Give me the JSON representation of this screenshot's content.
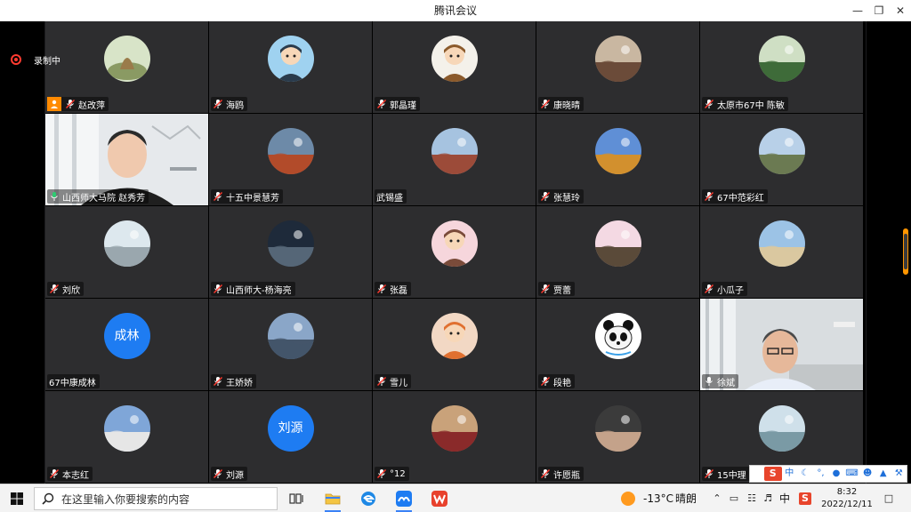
{
  "window": {
    "title": "腾讯会议"
  },
  "recording": {
    "label": "录制中"
  },
  "tiles": [
    {
      "name": "赵改萍",
      "kind": "avatar",
      "av": "landscape",
      "c1": "#d8e4c8",
      "c2": "#8a9a63",
      "host": true
    },
    {
      "name": "海鸥",
      "kind": "avatar",
      "av": "cartoon",
      "c1": "#9fd2f0",
      "c2": "#2a3b4c"
    },
    {
      "name": "郭晶瑾",
      "kind": "avatar",
      "av": "cartoon",
      "c1": "#f4f1ea",
      "c2": "#8b5a2b"
    },
    {
      "name": "康晓晴",
      "kind": "avatar",
      "av": "photo",
      "c1": "#c9b7a1",
      "c2": "#6b4b3a"
    },
    {
      "name": "太原市67中 陈敏",
      "kind": "avatar",
      "av": "photo",
      "c1": "#cfdfc4",
      "c2": "#3f6b3a"
    },
    {
      "name": "山西师大马院 赵秀芳",
      "kind": "video",
      "speaking": true
    },
    {
      "name": "十五中景慧芳",
      "kind": "avatar",
      "av": "photo",
      "c1": "#6d8aa8",
      "c2": "#b24b2a"
    },
    {
      "name": "武锡盛",
      "kind": "avatar",
      "av": "photo",
      "c1": "#a6c3e0",
      "c2": "#9c4b3a",
      "nomic": true
    },
    {
      "name": "张慧玲",
      "kind": "avatar",
      "av": "photo",
      "c1": "#5f8fd6",
      "c2": "#d2902e"
    },
    {
      "name": "67中范彩红",
      "kind": "avatar",
      "av": "photo",
      "c1": "#b8d0e8",
      "c2": "#6b7b52"
    },
    {
      "name": "刘欣",
      "kind": "avatar",
      "av": "photo",
      "c1": "#dde8ee",
      "c2": "#9aa7ae"
    },
    {
      "name": "山西师大-杨海亮",
      "kind": "avatar",
      "av": "photo",
      "c1": "#1e2a3a",
      "c2": "#556677"
    },
    {
      "name": "张磊",
      "kind": "avatar",
      "av": "cartoon",
      "c1": "#f6d6dc",
      "c2": "#7a4b3a"
    },
    {
      "name": "贾蕾",
      "kind": "avatar",
      "av": "photo",
      "c1": "#f4d9e3",
      "c2": "#5a4a3a"
    },
    {
      "name": "小瓜子",
      "kind": "avatar",
      "av": "photo",
      "c1": "#9cc3e6",
      "c2": "#d9c8a0"
    },
    {
      "name": "67中康成林",
      "kind": "avatar",
      "av": "text",
      "label": "成林",
      "nomic": true
    },
    {
      "name": "王娇娇",
      "kind": "avatar",
      "av": "photo",
      "c1": "#8aa6c8",
      "c2": "#44556a"
    },
    {
      "name": "雪儿",
      "kind": "avatar",
      "av": "cartoon",
      "c1": "#f2d8c4",
      "c2": "#e07030"
    },
    {
      "name": "段艳",
      "kind": "avatar",
      "av": "panda",
      "c1": "#ffffff",
      "c2": "#111111"
    },
    {
      "name": "徐斌",
      "kind": "video2",
      "mic": "on"
    },
    {
      "name": "本志红",
      "kind": "avatar",
      "av": "photo",
      "c1": "#7fa6d8",
      "c2": "#e6e6e6"
    },
    {
      "name": "刘源",
      "kind": "avatar",
      "av": "text",
      "label": "刘源"
    },
    {
      "name": "°12",
      "kind": "avatar",
      "av": "photo",
      "c1": "#c9a27a",
      "c2": "#8a2a2a"
    },
    {
      "name": "许愿瓶",
      "kind": "avatar",
      "av": "photo",
      "c1": "#3b3b3b",
      "c2": "#c4a28a"
    },
    {
      "name": "15中理",
      "kind": "avatar",
      "av": "photo",
      "c1": "#cfe0ea",
      "c2": "#7a9aa5"
    }
  ],
  "taskbar": {
    "search_placeholder": "在这里输入你要搜索的内容",
    "weather_temp": "-13°C",
    "weather_text": "晴朗",
    "ime_char": "中",
    "clock_time": "8:32",
    "clock_date": "2022/12/11"
  },
  "ime": {
    "mode": "中"
  },
  "colors": {
    "accent": "#1e7cf2",
    "record": "#ff3b30",
    "host": "#ff8a00",
    "speaking": "#2ecc71"
  }
}
